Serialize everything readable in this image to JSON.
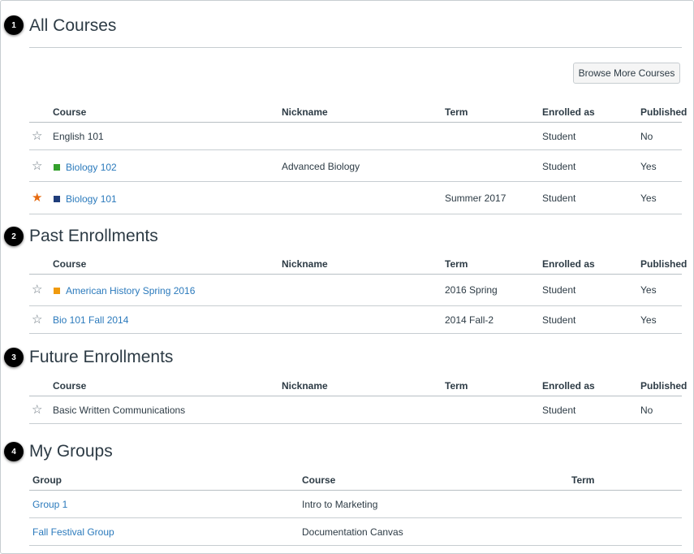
{
  "all_courses": {
    "callout": "1",
    "title": "All Courses",
    "browse_button": "Browse More Courses",
    "headers": {
      "course": "Course",
      "nickname": "Nickname",
      "term": "Term",
      "enrolled": "Enrolled as",
      "published": "Published"
    },
    "rows": [
      {
        "course": "English 101",
        "nickname": "",
        "term": "",
        "enrolled": "Student",
        "published": "No",
        "favorite": false,
        "color": "",
        "is_link": false
      },
      {
        "course": "Biology 102",
        "nickname": "Advanced Biology",
        "term": "",
        "enrolled": "Student",
        "published": "Yes",
        "favorite": false,
        "color": "#33a02c",
        "is_link": true
      },
      {
        "course": "Biology 101",
        "nickname": "",
        "term": "Summer 2017",
        "enrolled": "Student",
        "published": "Yes",
        "favorite": true,
        "color": "#1f3d7a",
        "is_link": true
      }
    ]
  },
  "past_enrollments": {
    "callout": "2",
    "title": "Past Enrollments",
    "headers": {
      "course": "Course",
      "nickname": "Nickname",
      "term": "Term",
      "enrolled": "Enrolled as",
      "published": "Published"
    },
    "rows": [
      {
        "course": "American History Spring 2016",
        "nickname": "",
        "term": "2016 Spring",
        "enrolled": "Student",
        "published": "Yes",
        "favorite": false,
        "color": "#f09a0e",
        "is_link": true
      },
      {
        "course": "Bio 101 Fall 2014",
        "nickname": "",
        "term": "2014 Fall-2",
        "enrolled": "Student",
        "published": "Yes",
        "favorite": false,
        "color": "",
        "is_link": true
      }
    ]
  },
  "future_enrollments": {
    "callout": "3",
    "title": "Future Enrollments",
    "headers": {
      "course": "Course",
      "nickname": "Nickname",
      "term": "Term",
      "enrolled": "Enrolled as",
      "published": "Published"
    },
    "rows": [
      {
        "course": "Basic Written Communications",
        "nickname": "",
        "term": "",
        "enrolled": "Student",
        "published": "No",
        "favorite": false,
        "color": "",
        "is_link": false
      }
    ]
  },
  "my_groups": {
    "callout": "4",
    "title": "My Groups",
    "headers": {
      "group": "Group",
      "course": "Course",
      "term": "Term"
    },
    "rows": [
      {
        "group": "Group 1",
        "course": "Intro to Marketing",
        "term": ""
      },
      {
        "group": "Fall Festival Group",
        "course": "Documentation Canvas",
        "term": ""
      }
    ]
  },
  "icons": {
    "star_empty": "star-outline-icon",
    "star_filled": "star-filled-icon"
  },
  "colors": {
    "link": "#2b7abc",
    "favorite_star": "#e66a10",
    "text": "#2d3b45",
    "border": "#c7cdd1"
  }
}
